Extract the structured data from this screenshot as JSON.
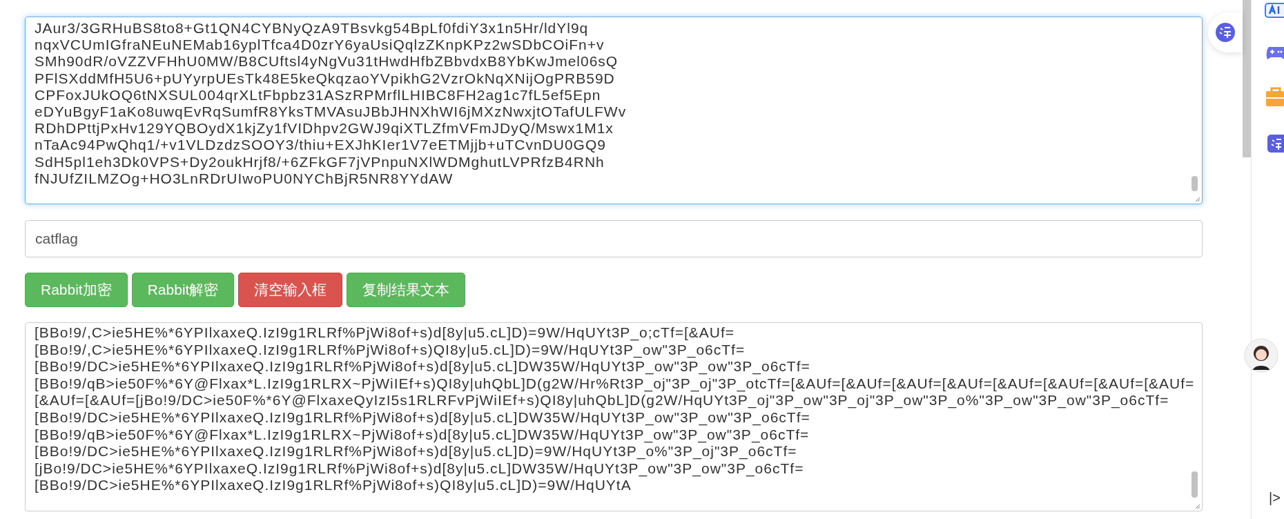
{
  "input_area": {
    "lines": [
      "JAur3/3GRHuBS8to8+Gt1QN4CYBNyQzA9TBsvkg54BpLf0fdiY3x1n5Hr/ldYl9q",
      "nqxVCUmIGfraNEuNEMab16yplTfca4D0zrY6yaUsiQqlzZKnpKPz2wSDbCOiFn+v",
      "SMh90dR/oVZZVFHhU0MW/B8CUftsl4yNgVu31tHwdHfbZBbvdxB8YbKwJmel06sQ",
      "PFlSXddMfH5U6+pUYyrpUEsTk48E5keQkqzaoYVpikhG2VzrOkNqXNijOgPRB59D",
      "CPFoxJUkOQ6tNXSUL004qrXLtFbpbz31ASzRPMrflLHIBC8FH2ag1c7fL5ef5Epn",
      "eDYuBgyF1aKo8uwqEvRqSumfR8YksTMVAsuJBbJHNXhWI6jMXzNwxjtOTafULFWv",
      "RDhDPttjPxHv129YQBOydX1kjZy1fVIDhpv2GWJ9qiXTLZfmVFmJDyQ/Mswx1M1x",
      "nTaAc94PwQhq1/+v1VLDzdzSOOY3/thiu+EXJhKIer1V7eETMjjb+uTCvnDU0GQ9",
      "SdH5pl1eh3Dk0VPS+Dy2oukHrjf8/+6ZFkGF7jVPnpuNXlWDMghutLVPRfzB4RNh",
      "fNJUfZILMZOg+HO3LnRDrUIwoPU0NYChBjR5NR8YYdAW"
    ]
  },
  "key_field": {
    "value": "catflag"
  },
  "buttons": [
    {
      "label": "Rabbit加密",
      "kind": "success"
    },
    {
      "label": "Rabbit解密",
      "kind": "success"
    },
    {
      "label": "清空输入框",
      "kind": "danger"
    },
    {
      "label": "复制结果文本",
      "kind": "success"
    }
  ],
  "output_area": {
    "lines": [
      "[BBo!9/,C>ie5HE%*6YPIlxaxeQ.IzI9g1RLRf%PjWi8of+s)d[8y|u5.cL]D)=9W/HqUYt3P_o;cTf=[&AUf=",
      "[BBo!9/,C>ie5HE%*6YPIlxaxeQ.IzI9g1RLRf%PjWi8of+s)QI8y|u5.cL]D)=9W/HqUYt3P_ow\"3P_o6cTf=",
      "[BBo!9/DC>ie5HE%*6YPIlxaxeQ.IzI9g1RLRf%PjWi8of+s)d[8y|u5.cL]DW35W/HqUYt3P_ow\"3P_ow\"3P_o6cTf=",
      "[BBo!9/qB>ie50F%*6Y@Flxax*L.IzI9g1RLRX~PjWiIEf+s)QI8y|uhQbL]D(g2W/Hr%Rt3P_oj\"3P_oj\"3P_otcTf=[&AUf=[&AUf=[&AUf=[&AUf=[&AUf=[&AUf=[&AUf=[&AUf=",
      "[&AUf=[&AUf=[jBo!9/DC>ie50F%*6Y@FlxaxeQyIzI5s1RLRFvPjWiIEf+s)QI8y|uhQbL]D(g2W/HqUYt3P_oj\"3P_ow\"3P_oj\"3P_ow\"3P_o%\"3P_ow\"3P_ow\"3P_o6cTf=",
      "[BBo!9/DC>ie5HE%*6YPIlxaxeQ.IzI9g1RLRf%PjWi8of+s)d[8y|u5.cL]DW35W/HqUYt3P_ow\"3P_ow\"3P_o6cTf=",
      "[BBo!9/qB>ie50F%*6Y@Flxax*L.IzI9g1RLRX~PjWi8of+s)d[8y|u5.cL]DW35W/HqUYt3P_ow\"3P_ow\"3P_o6cTf=",
      "[BBo!9/DC>ie5HE%*6YPIlxaxeQ.IzI9g1RLRf%PjWi8of+s)d[8y|u5.cL]D)=9W/HqUYt3P_o%\"3P_oj\"3P_o6cTf=",
      "[jBo!9/DC>ie5HE%*6YPIlxaxeQ.IzI9g1RLRf%PjWi8of+s)d[8y|u5.cL]DW35W/HqUYt3P_ow\"3P_ow\"3P_o6cTf=",
      "[BBo!9/DC>ie5HE%*6YPIlxaxeQ.IzI9g1RLRf%PjWi8of+s)QI8y|u5.cL]D)=9W/HqUYtA"
    ]
  },
  "side_toggle": {
    "label": "|>"
  }
}
